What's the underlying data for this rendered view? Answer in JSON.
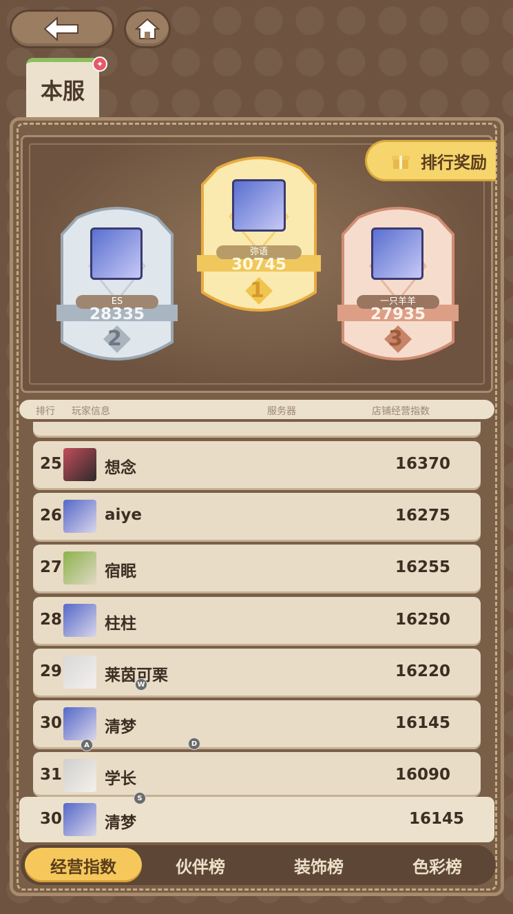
{
  "topbar": {
    "back_icon": "back-arrow-icon",
    "home_icon": "home-icon"
  },
  "server_tab": {
    "label": "本服"
  },
  "reward_button": {
    "label": "排行奖励"
  },
  "podium": [
    {
      "rank": "1",
      "name": "弥语",
      "score": "30745"
    },
    {
      "rank": "2",
      "name": "ES",
      "score": "28335"
    },
    {
      "rank": "3",
      "name": "一只羊羊",
      "score": "27935"
    }
  ],
  "list_header": {
    "rank": "排行",
    "player": "玩家信息",
    "server": "服务器",
    "index": "店铺经营指数"
  },
  "rows": [
    {
      "rank": "25",
      "name": "想念",
      "score": "16370"
    },
    {
      "rank": "26",
      "name": "aiye",
      "score": "16275"
    },
    {
      "rank": "27",
      "name": "宿眠",
      "score": "16255"
    },
    {
      "rank": "28",
      "name": "柱柱",
      "score": "16250"
    },
    {
      "rank": "29",
      "name": "莱茵可栗",
      "score": "16220"
    },
    {
      "rank": "30",
      "name": "清梦",
      "score": "16145"
    },
    {
      "rank": "31",
      "name": "学长",
      "score": "16090"
    }
  ],
  "my_row": {
    "rank": "30",
    "name": "清梦",
    "score": "16145"
  },
  "bottom_tabs": [
    {
      "label": "经营指数",
      "active": true
    },
    {
      "label": "伙伴榜",
      "active": false
    },
    {
      "label": "装饰榜",
      "active": false
    },
    {
      "label": "色彩榜",
      "active": false
    }
  ],
  "key_hints": [
    "W",
    "A",
    "D",
    "S"
  ],
  "colors": {
    "gold": "#f6c85c",
    "silver": "#b9c3cc",
    "bronze": "#e1a68c",
    "board": "#7a5f48"
  }
}
